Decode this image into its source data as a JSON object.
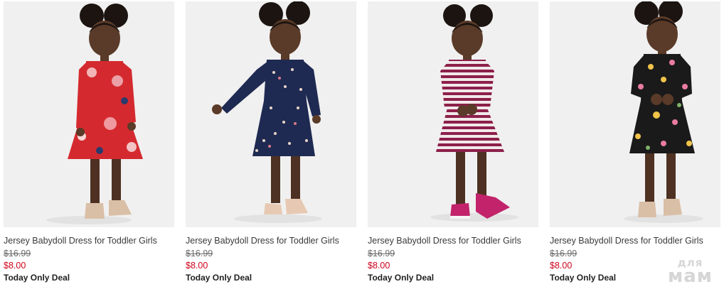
{
  "products": [
    {
      "title": "Jersey Babydoll Dress for Toddler Girls",
      "original_price": "$16.99",
      "sale_price": "$8.00",
      "badge": "Today Only Deal",
      "dress_color": "#d42a2f",
      "pattern": "red-floral",
      "shoe_color": "#d9bfa6"
    },
    {
      "title": "Jersey Babydoll Dress for Toddler Girls",
      "original_price": "$16.99",
      "sale_price": "$8.00",
      "badge": "Today Only Deal",
      "dress_color": "#1f2a52",
      "pattern": "navy-ditsy-floral",
      "shoe_color": "#e7c9b3"
    },
    {
      "title": "Jersey Babydoll Dress for Toddler Girls",
      "original_price": "$16.99",
      "sale_price": "$8.00",
      "badge": "Today Only Deal",
      "dress_color": "#f2e8ea",
      "pattern": "magenta-stripes",
      "shoe_color": "#c2236b"
    },
    {
      "title": "Jersey Babydoll Dress for Toddler Girls",
      "original_price": "$16.99",
      "sale_price": "$8.00",
      "badge": "Today Only Deal",
      "dress_color": "#1a1a1a",
      "pattern": "black-floral",
      "shoe_color": "#d9bfa6"
    }
  ],
  "watermark": {
    "line1": "для",
    "line2": "мам"
  }
}
